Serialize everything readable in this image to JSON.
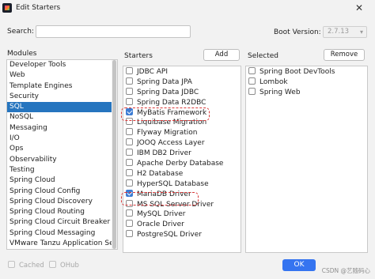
{
  "window": {
    "title": "Edit Starters",
    "close_glyph": "✕"
  },
  "search": {
    "label": "Search:",
    "value": ""
  },
  "boot_version": {
    "label": "Boot Version:",
    "value": "2.7.13"
  },
  "modules": {
    "header": "Modules",
    "items": [
      "Developer Tools",
      "Web",
      "Template Engines",
      "Security",
      "SQL",
      "NoSQL",
      "Messaging",
      "I/O",
      "Ops",
      "Observability",
      "Testing",
      "Spring Cloud",
      "Spring Cloud Config",
      "Spring Cloud Discovery",
      "Spring Cloud Routing",
      "Spring Cloud Circuit Breaker",
      "Spring Cloud Messaging",
      "VMware Tanzu Application Service"
    ],
    "selected": "SQL"
  },
  "starters": {
    "header": "Starters",
    "add_label": "Add",
    "items": [
      {
        "label": "JDBC API",
        "checked": false
      },
      {
        "label": "Spring Data JPA",
        "checked": false
      },
      {
        "label": "Spring Data JDBC",
        "checked": false
      },
      {
        "label": "Spring Data R2DBC",
        "checked": false
      },
      {
        "label": "MyBatis Framework",
        "checked": true
      },
      {
        "label": "Liquibase Migration",
        "checked": false
      },
      {
        "label": "Flyway Migration",
        "checked": false
      },
      {
        "label": "JOOQ Access Layer",
        "checked": false
      },
      {
        "label": "IBM DB2 Driver",
        "checked": false
      },
      {
        "label": "Apache Derby Database",
        "checked": false
      },
      {
        "label": "H2 Database",
        "checked": false
      },
      {
        "label": "HyperSQL Database",
        "checked": false
      },
      {
        "label": "MariaDB Driver",
        "checked": true
      },
      {
        "label": "MS SQL Server Driver",
        "checked": false
      },
      {
        "label": "MySQL Driver",
        "checked": false
      },
      {
        "label": "Oracle Driver",
        "checked": false
      },
      {
        "label": "PostgreSQL Driver",
        "checked": false
      }
    ]
  },
  "selected": {
    "header": "Selected",
    "remove_label": "Remove",
    "items": [
      "Spring Boot DevTools",
      "Lombok",
      "Spring Web"
    ]
  },
  "footer": {
    "cached_label": "Cached",
    "ohub_label": "OHub",
    "ok_label": "OK",
    "watermark": "CSDN @艺随码心"
  },
  "colors": {
    "accent": "#3574f0",
    "selection": "#2675bf",
    "highlight": "#d93a3a"
  }
}
